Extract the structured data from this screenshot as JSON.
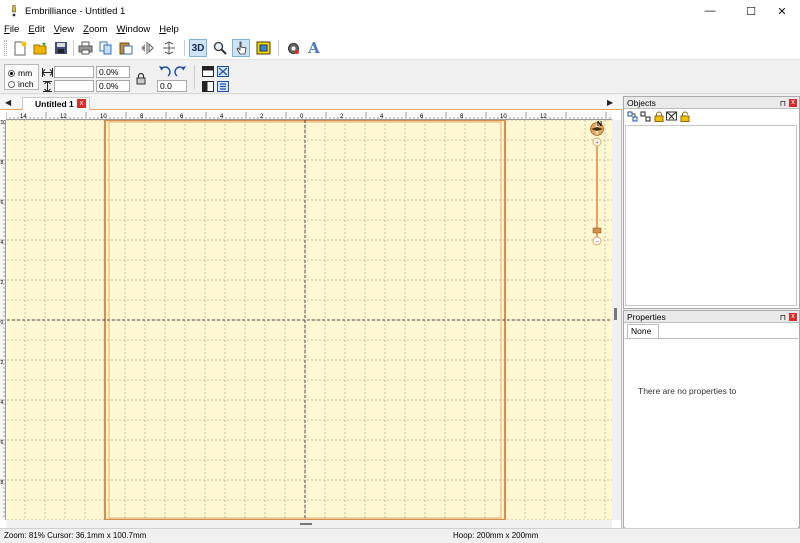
{
  "window": {
    "title": "Embrilliance -  Untitled 1",
    "controls": {
      "minimize": "—",
      "maximize": "☐",
      "close": "✕"
    }
  },
  "menu": [
    {
      "label": "File",
      "mnemonic": "F"
    },
    {
      "label": "Edit",
      "mnemonic": "E"
    },
    {
      "label": "View",
      "mnemonic": "V"
    },
    {
      "label": "Zoom",
      "mnemonic": "Z"
    },
    {
      "label": "Window",
      "mnemonic": "W"
    },
    {
      "label": "Help",
      "mnemonic": "H"
    }
  ],
  "toolbar": {
    "three_d_label": "3D",
    "text_tool_label": "A",
    "icons": [
      "new-document-icon",
      "open-folder-icon",
      "save-icon",
      "print-icon",
      "copy-icon",
      "paste-icon",
      "mirror-horizontal-icon",
      "mirror-vertical-icon",
      "3d-view-icon",
      "zoom-icon",
      "select-pointer-icon",
      "hoop-icon",
      "settings-gear-icon",
      "text-tool-icon"
    ]
  },
  "properties_bar": {
    "units": {
      "mm_label": "mm",
      "inch_label": "inch",
      "selected": "mm"
    },
    "width_value": "",
    "height_value": "",
    "width_percent": "0.0%",
    "height_percent": "0.0%",
    "rotation_value": "0.0"
  },
  "document": {
    "tab_label": "Untitled 1",
    "close_label": "x",
    "compass_label": "N"
  },
  "rulers": {
    "top_labels": [
      "14",
      "12",
      "10",
      "8",
      "6",
      "4",
      "2",
      "0",
      "2",
      "4",
      "6",
      "8",
      "10",
      "12"
    ],
    "left_labels": [
      "10",
      "8",
      "6",
      "4",
      "2",
      "0",
      "2",
      "4",
      "6",
      "8",
      "10"
    ]
  },
  "panels": {
    "objects": {
      "title": "Objects",
      "pin": "⊓",
      "close": "x"
    },
    "properties": {
      "title": "Properties",
      "pin": "⊓",
      "close": "x",
      "tab_label": "None",
      "empty_message": "There are no properties to"
    }
  },
  "status": {
    "left": "Zoom: 81%  Cursor: 36.1mm x 100.7mm",
    "right": "Hoop: 200mm x 200mm"
  },
  "colors": {
    "canvas_background": "#fff8d3",
    "hoop_border": "#d6904e",
    "accent_orange": "#e7a45a",
    "close_red": "#d62d2d"
  }
}
